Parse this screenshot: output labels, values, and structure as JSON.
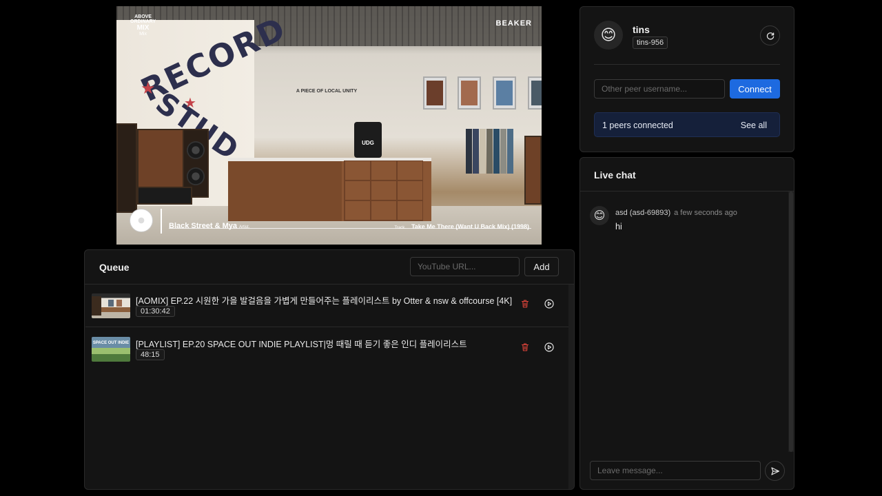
{
  "video": {
    "overlay_logo": [
      "ABOVE",
      "ORDINARY",
      "MIX",
      "Mix"
    ],
    "brand": "BEAKER",
    "wall_text": "A PIECE OF LOCAL UNITY",
    "mural_top": "RECORD",
    "mural_bottom": "STUD",
    "artist": "Black Street & Mya",
    "artist_label": "Artist.",
    "track_label": "Track.",
    "track": "Take Me There (Want U Back Mix) (1998)",
    "counter_sign": "UDG"
  },
  "queue": {
    "title": "Queue",
    "url_placeholder": "YouTube URL...",
    "add_label": "Add",
    "items": [
      {
        "title": "[AOMIX] EP.22 시원한 가을 발걸음을 가볍게 만들어주는 플레이리스트 by Otter & nsw & offcourse [4K]",
        "duration": "01:30:42"
      },
      {
        "title": "[PLAYLIST] EP.20 SPACE OUT INDIE PLAYLIST|멍 때릴 때 듣기 좋은 인디 플레이리스트",
        "duration": "48:15",
        "thumb_text": "SPACE OUT INDIE"
      }
    ]
  },
  "profile": {
    "avatar_icon": "smiling-face-icon",
    "name": "tins",
    "id": "tins-956",
    "peer_placeholder": "Other peer username...",
    "connect_label": "Connect",
    "peers_connected": "1 peers connected",
    "see_all_label": "See all"
  },
  "chat": {
    "title": "Live chat",
    "messages": [
      {
        "author": "asd (asd-69893)",
        "time": "a few seconds ago",
        "text": "hi"
      }
    ],
    "input_placeholder": "Leave message..."
  },
  "colors": {
    "accent": "#1d6ae0",
    "delete": "#e0443a",
    "panel_bg": "#141414",
    "peers_bg": "#15203a"
  }
}
